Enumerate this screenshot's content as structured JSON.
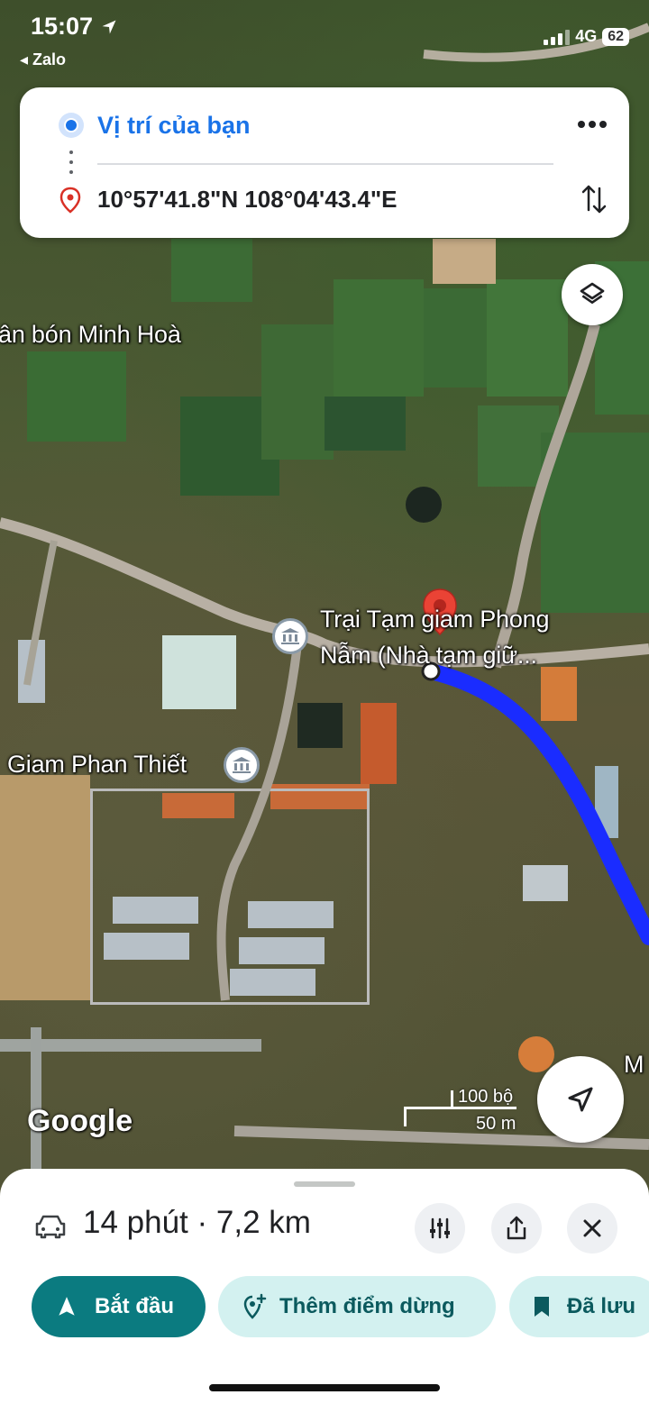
{
  "status_bar": {
    "time": "15:07",
    "back_app": "Zalo",
    "network": "4G",
    "battery": "62"
  },
  "route": {
    "origin": "Vị trí của bạn",
    "destination": "10°57'41.8\"N 108°04'43.4\"E"
  },
  "map": {
    "labels": {
      "minh_hoa": "ân bón Minh Hoà",
      "trai_tam_line1": "Trại Tạm giam Phong",
      "trai_tam_line2": "Nẫm (Nhà tạm giữ...",
      "giam_phan_thiet": "Giam Phan Thiết",
      "edge": "M",
      "google": "Google"
    },
    "scale": {
      "imperial": "100 bộ",
      "metric": "50 m"
    },
    "route_color": "#1a2cff"
  },
  "sheet": {
    "summary": "14 phút · 7,2 km",
    "start_label": "Bắt đầu",
    "add_stop_label": "Thêm điểm dừng",
    "saved_label": "Đã lưu"
  },
  "icons": [
    "location-dot-icon",
    "pin-icon",
    "more-icon",
    "swap-icon",
    "layers-icon",
    "recenter-icon",
    "car-icon",
    "options-icon",
    "share-icon",
    "close-icon",
    "navigate-icon",
    "add-stop-icon",
    "bookmark-icon"
  ]
}
